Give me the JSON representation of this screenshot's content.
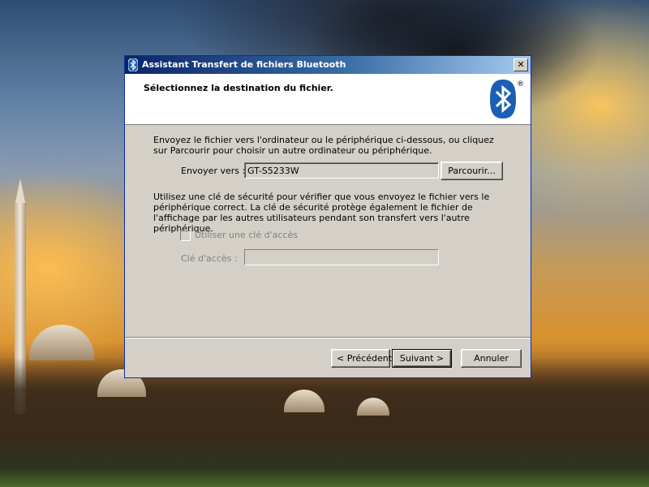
{
  "window": {
    "title": "Assistant Transfert de fichiers Bluetooth",
    "close_glyph": "✕"
  },
  "header": {
    "heading": "Sélectionnez la destination du fichier.",
    "logo_icon": "bluetooth-logo-icon",
    "registered_mark": "®"
  },
  "content": {
    "intro": "Envoyez le fichier vers l'ordinateur ou le périphérique ci-dessous, ou cliquez sur Parcourir pour choisir un autre ordinateur ou périphérique.",
    "send_to_label": "Envoyer vers :",
    "send_to_value": "GT-S5233W",
    "browse_label": "Parcourir...",
    "security_text": "Utilisez une clé de sécurité pour vérifier que vous envoyez le fichier vers le périphérique correct. La clé de sécurité protège également le fichier de l'affichage par les autres utilisateurs pendant son transfert vers l'autre périphérique.",
    "use_key_label": "Utiliser une clé d'accès",
    "use_key_checked": false,
    "key_label": "Clé d'accès :",
    "key_value": ""
  },
  "footer": {
    "back_label": "< Précédent",
    "next_label": "Suivant >",
    "cancel_label": "Annuler"
  },
  "colors": {
    "dialog_face": "#d4d0c8",
    "titlebar_start": "#0a246a",
    "titlebar_end": "#a6caf0",
    "bluetooth_blue": "#1a5fb4"
  }
}
